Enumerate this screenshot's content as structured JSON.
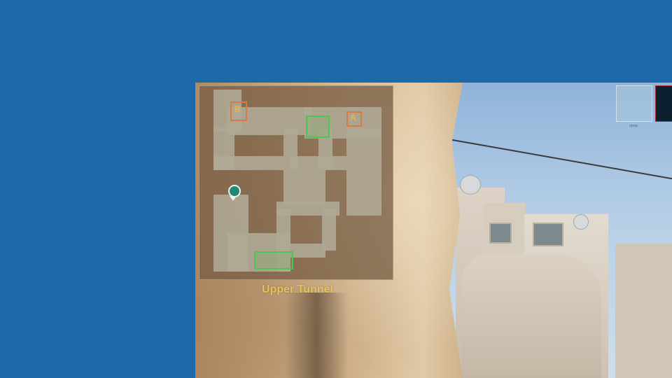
{
  "game": {
    "minimap": {
      "sites": [
        {
          "label": "B"
        },
        {
          "label": "A"
        }
      ],
      "player_marker": "player-position-icon"
    },
    "location": "Upper Tunnel",
    "hud": {
      "top_right_label": "ᵒᵖᵒᵖ"
    }
  },
  "colors": {
    "background": "#1e69a8",
    "location_text": "#e8c25a",
    "site_zone": "#d87a45",
    "spawn_zone": "#4cc552",
    "player": "#1e8a72"
  }
}
